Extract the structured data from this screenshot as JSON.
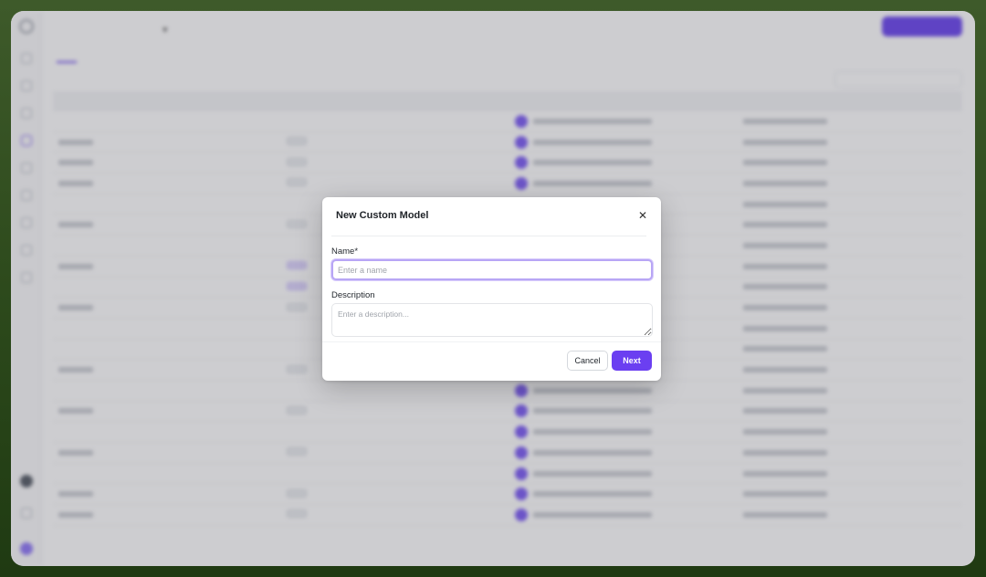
{
  "modal": {
    "title": "New Custom Model",
    "close_icon": "close-icon",
    "name_label": "Name*",
    "name_placeholder": "Enter a name",
    "name_value": "",
    "description_label": "Description",
    "description_placeholder": "Enter a description...",
    "description_value": "",
    "cancel_label": "Cancel",
    "next_label": "Next"
  },
  "colors": {
    "accent": "#6b3ff1",
    "input_focus_border": "#b8a6f5",
    "background_gradient_top": "#3e5a2a",
    "background_gradient_bottom": "#1f3a12"
  }
}
